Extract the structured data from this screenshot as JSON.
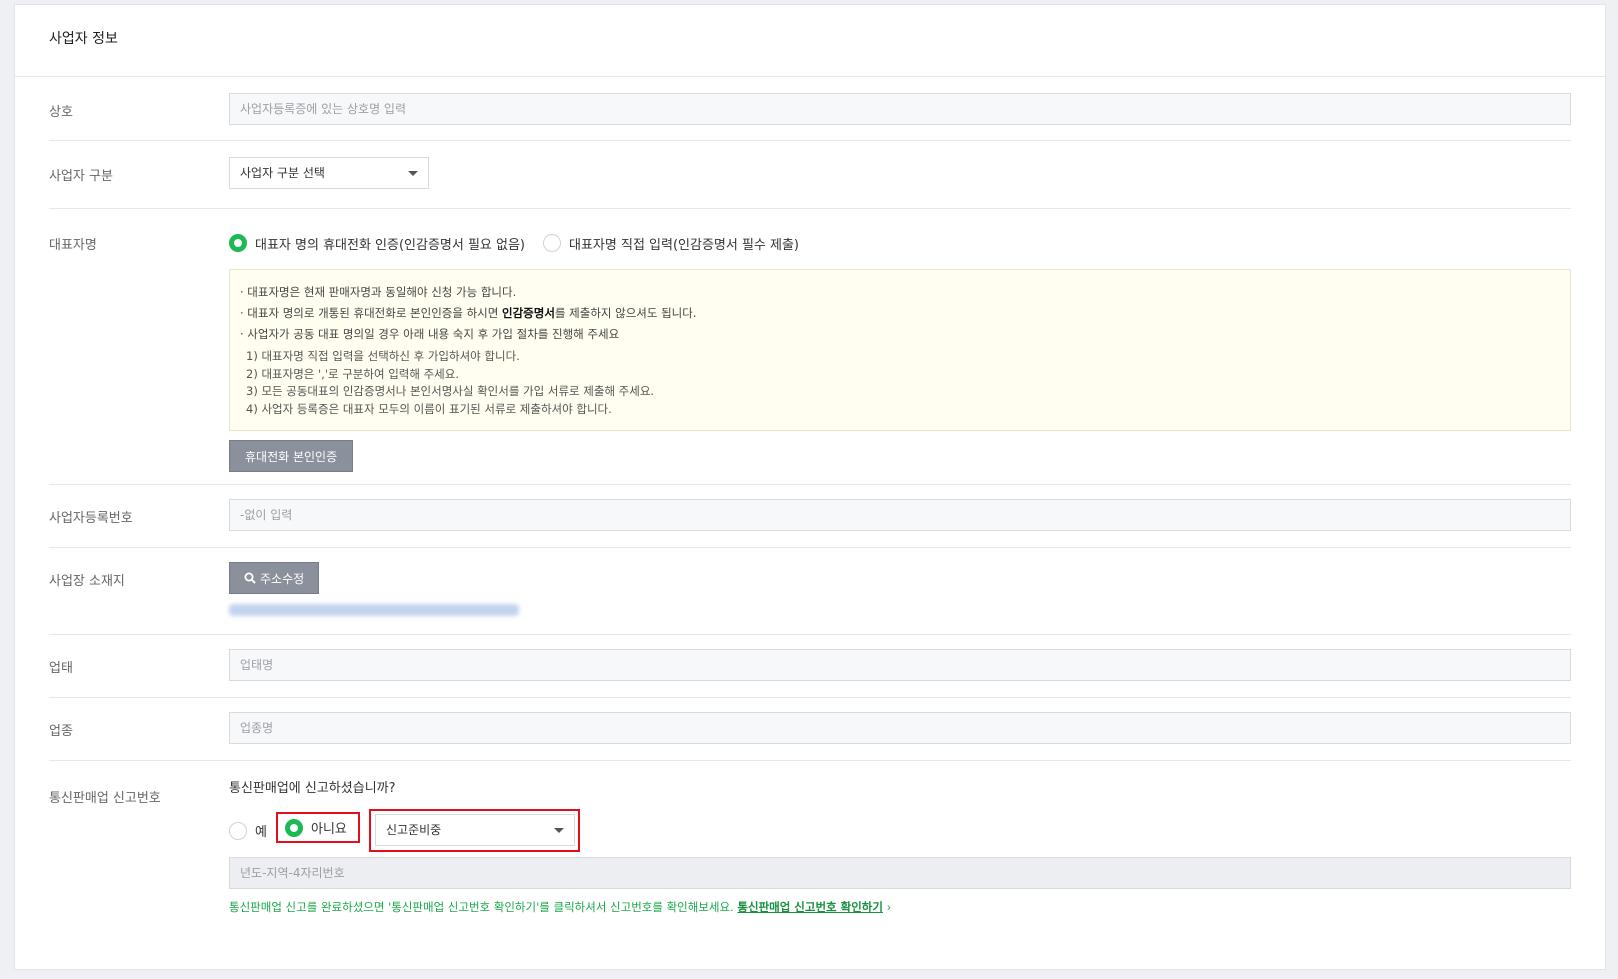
{
  "section_title": "사업자 정보",
  "fields": {
    "company": {
      "label": "상호",
      "placeholder": "사업자등록증에 있는 상호명 입력"
    },
    "biz_type": {
      "label": "사업자 구분",
      "selected": "사업자 구분 선택"
    },
    "rep": {
      "label": "대표자명",
      "option1": "대표자 명의 휴대전화 인증(인감증명서 필요 없음)",
      "option2": "대표자명 직접 입력(인감증명서 필수 제출)",
      "selected_option": 1,
      "notice": {
        "line1": "· 대표자명은 현재 판매자명과 동일해야 신청 가능 합니다.",
        "line2_pre": "· 대표자 명의로 개통된 휴대전화로 본인인증을 하시면 ",
        "line2_bold": "인감증명서",
        "line2_post": "를 제출하지 않으셔도 됩니다.",
        "line3": "· 사업자가 공동 대표 명의일 경우 아래 내용 숙지 후 가입 절차를 진행해 주세요",
        "sub1": "1) 대표자명 직접 입력을 선택하신 후 가입하셔야 합니다.",
        "sub2": "2) 대표자명은 ','로 구분하여 입력해 주세요.",
        "sub3": "3) 모든 공동대표의 인감증명서나 본인서명사실 확인서를 가입 서류로 제출해 주세요.",
        "sub4": "4) 사업자 등록증은 대표자 모두의 이름이 표기된 서류로 제출하셔야 합니다."
      },
      "verify_button": "휴대전화 본인인증"
    },
    "reg_number": {
      "label": "사업자등록번호",
      "placeholder": "-없이 입력"
    },
    "address": {
      "label": "사업장 소재지",
      "button": "주소수정"
    },
    "business": {
      "label": "업태",
      "placeholder": "업태명"
    },
    "category": {
      "label": "업종",
      "placeholder": "업종명"
    },
    "mail_order": {
      "label": "통신판매업 신고번호",
      "question": "통신판매업에 신고하셨습니까?",
      "yes": "예",
      "no": "아니요",
      "selected": "아니요",
      "status_select": "신고준비중",
      "number_placeholder": "년도-지역-4자리번호",
      "help_text": "통신판매업 신고를 완료하셨으면 '통신판매업 신고번호 확인하기'를 클릭하셔서 신고번호를 확인해보세요. ",
      "help_link": "통신판매업 신고번호 확인하기",
      "help_arrow": "›"
    }
  },
  "colors": {
    "accent": "#1db954",
    "highlight": "#e10e1c"
  }
}
